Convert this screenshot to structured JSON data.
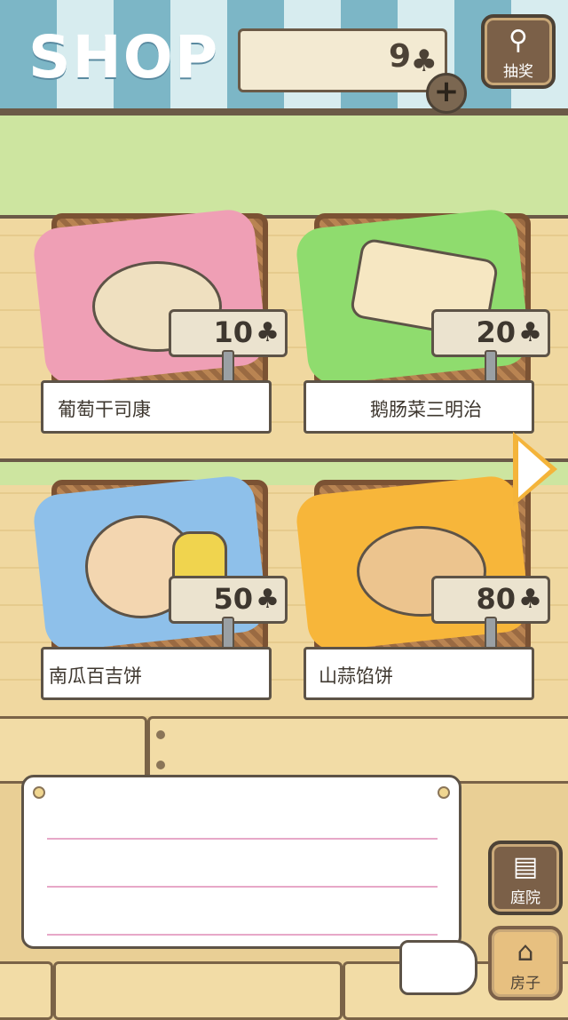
{
  "header": {
    "title": "SHOP",
    "clover_count": "9",
    "clover_symbol": "♣",
    "add_symbol": "+"
  },
  "side_buttons": {
    "lottery_label": "抽奖",
    "yard_label": "庭院",
    "house_label": "房子"
  },
  "items": [
    {
      "name": "葡萄干司康",
      "price": "10",
      "cloth_color": "#ef9fb5",
      "food_color": "#efe0c0"
    },
    {
      "name": "鹅肠菜三明治",
      "price": "20",
      "cloth_color": "#8fdc6e",
      "food_color": "#f6e7c2"
    },
    {
      "name": "南瓜百吉饼",
      "price": "50",
      "cloth_color": "#8ec0ea",
      "food_color": "#f3d6b0"
    },
    {
      "name": "山蒜馅饼",
      "price": "80",
      "cloth_color": "#f7b63a",
      "food_color": "#ecc48e"
    }
  ],
  "colors": {
    "awning_blue": "#7cb6c6",
    "wall_green": "#cde5a0",
    "arrow_orange": "#f4b43a"
  },
  "message_board": {
    "text": ""
  }
}
